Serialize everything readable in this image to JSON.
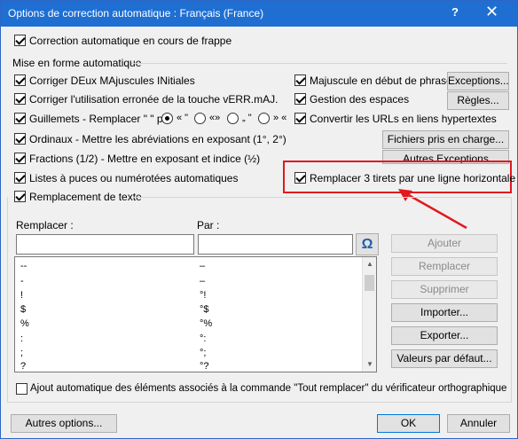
{
  "window": {
    "title": "Options de correction automatique : Français (France)",
    "help_glyph": "?",
    "close_glyph": "✕"
  },
  "options": {
    "correction_frappe": {
      "label": "Correction automatique en cours de frappe",
      "checked": true
    }
  },
  "group": {
    "title": "Mise en forme automatique"
  },
  "left_checks": [
    {
      "label": "Corriger DEux MAjuscules INitiales",
      "checked": true
    },
    {
      "label": "Corriger l'utilisation erronée de la touche vERR.mAJ.",
      "checked": true
    },
    {
      "label": "Guillemets - Remplacer \" \" par",
      "checked": true
    },
    {
      "label": "Ordinaux - Mettre les abréviations en exposant (1°, 2°)",
      "checked": true
    },
    {
      "label": "Fractions (1/2) - Mettre en exposant et indice (½)",
      "checked": true
    },
    {
      "label": "Listes à puces ou numérotées automatiques",
      "checked": true
    }
  ],
  "quotes": [
    {
      "label": "« \"",
      "selected": true
    },
    {
      "label": "«»",
      "selected": false
    },
    {
      "label": "„ \"",
      "selected": false
    },
    {
      "label": "» «",
      "selected": false
    }
  ],
  "right_checks": [
    {
      "label": "Majuscule en début de phrase",
      "checked": true
    },
    {
      "label": "Gestion des espaces",
      "checked": true
    },
    {
      "label": "Convertir les URLs en liens hypertextes",
      "checked": true
    },
    {
      "label": "Remplacer 3 tirets par une ligne horizontale",
      "checked": true
    }
  ],
  "right_buttons": {
    "exceptions": "Exceptions...",
    "regles": "Règles...",
    "fichiers": "Fichiers pris en charge...",
    "autres_exceptions": "Autres Exceptions"
  },
  "replacement": {
    "checkbox_label": "Remplacement de texte",
    "checked": true,
    "replace_label": "Remplacer :",
    "by_label": "Par :",
    "replace_value": "",
    "by_value": "",
    "omega_glyph": "Ω",
    "entries": [
      {
        "from": "--",
        "to": "–"
      },
      {
        "from": "-",
        "to": "–"
      },
      {
        "from": "!",
        "to": "°!"
      },
      {
        "from": "$",
        "to": "°$"
      },
      {
        "from": "%",
        "to": "°%"
      },
      {
        "from": ":",
        "to": "°:"
      },
      {
        "from": ";",
        "to": "°;"
      },
      {
        "from": "?",
        "to": "°?"
      }
    ],
    "buttons": {
      "ajouter": "Ajouter",
      "remplacer": "Remplacer",
      "supprimer": "Supprimer",
      "importer": "Importer...",
      "exporter": "Exporter...",
      "valeurs": "Valeurs par défaut..."
    }
  },
  "ajout_auto": {
    "label": "Ajout automatique des éléments associés à la commande \"Tout remplacer\" du vérificateur orthographique",
    "checked": false
  },
  "footer": {
    "autres_options": "Autres options...",
    "ok": "OK",
    "annuler": "Annuler"
  },
  "colors": {
    "titlebar": "#1f6fd3",
    "highlight": "#e0191f",
    "accent": "#0078d7"
  }
}
